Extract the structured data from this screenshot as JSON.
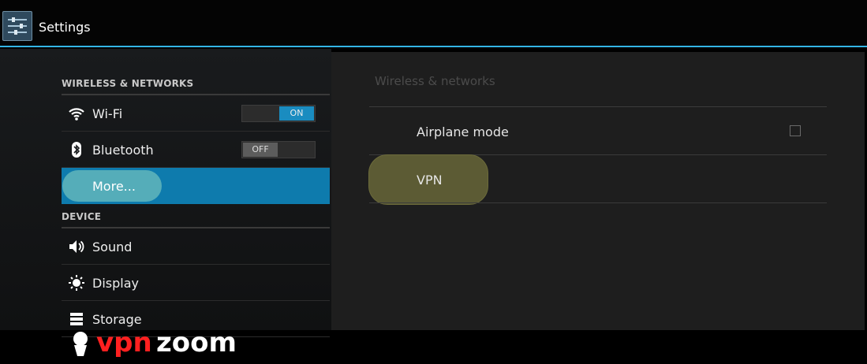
{
  "app": {
    "title": "Settings",
    "icon": "settings-sliders-icon"
  },
  "left": {
    "wireless_header": "WIRELESS & NETWORKS",
    "device_header": "DEVICE",
    "items": [
      {
        "label": "Wi-Fi",
        "icon": "wifi-icon",
        "toggle": "ON"
      },
      {
        "label": "Bluetooth",
        "icon": "bluetooth-icon",
        "toggle": "OFF"
      },
      {
        "label": "More...",
        "icon": "",
        "selected": true
      },
      {
        "label": "Sound",
        "icon": "speaker-icon"
      },
      {
        "label": "Display",
        "icon": "display-icon"
      },
      {
        "label": "Storage",
        "icon": "storage-icon"
      }
    ]
  },
  "right": {
    "header": "Wireless & networks",
    "airplane_label": "Airplane mode",
    "airplane_checked": false,
    "vpn_label": "VPN"
  },
  "watermark": {
    "text": "vpnzoom"
  },
  "colors": {
    "accent": "#33b5e5",
    "selected": "#0e7bad",
    "toggle_on": "#1a8cc0"
  }
}
